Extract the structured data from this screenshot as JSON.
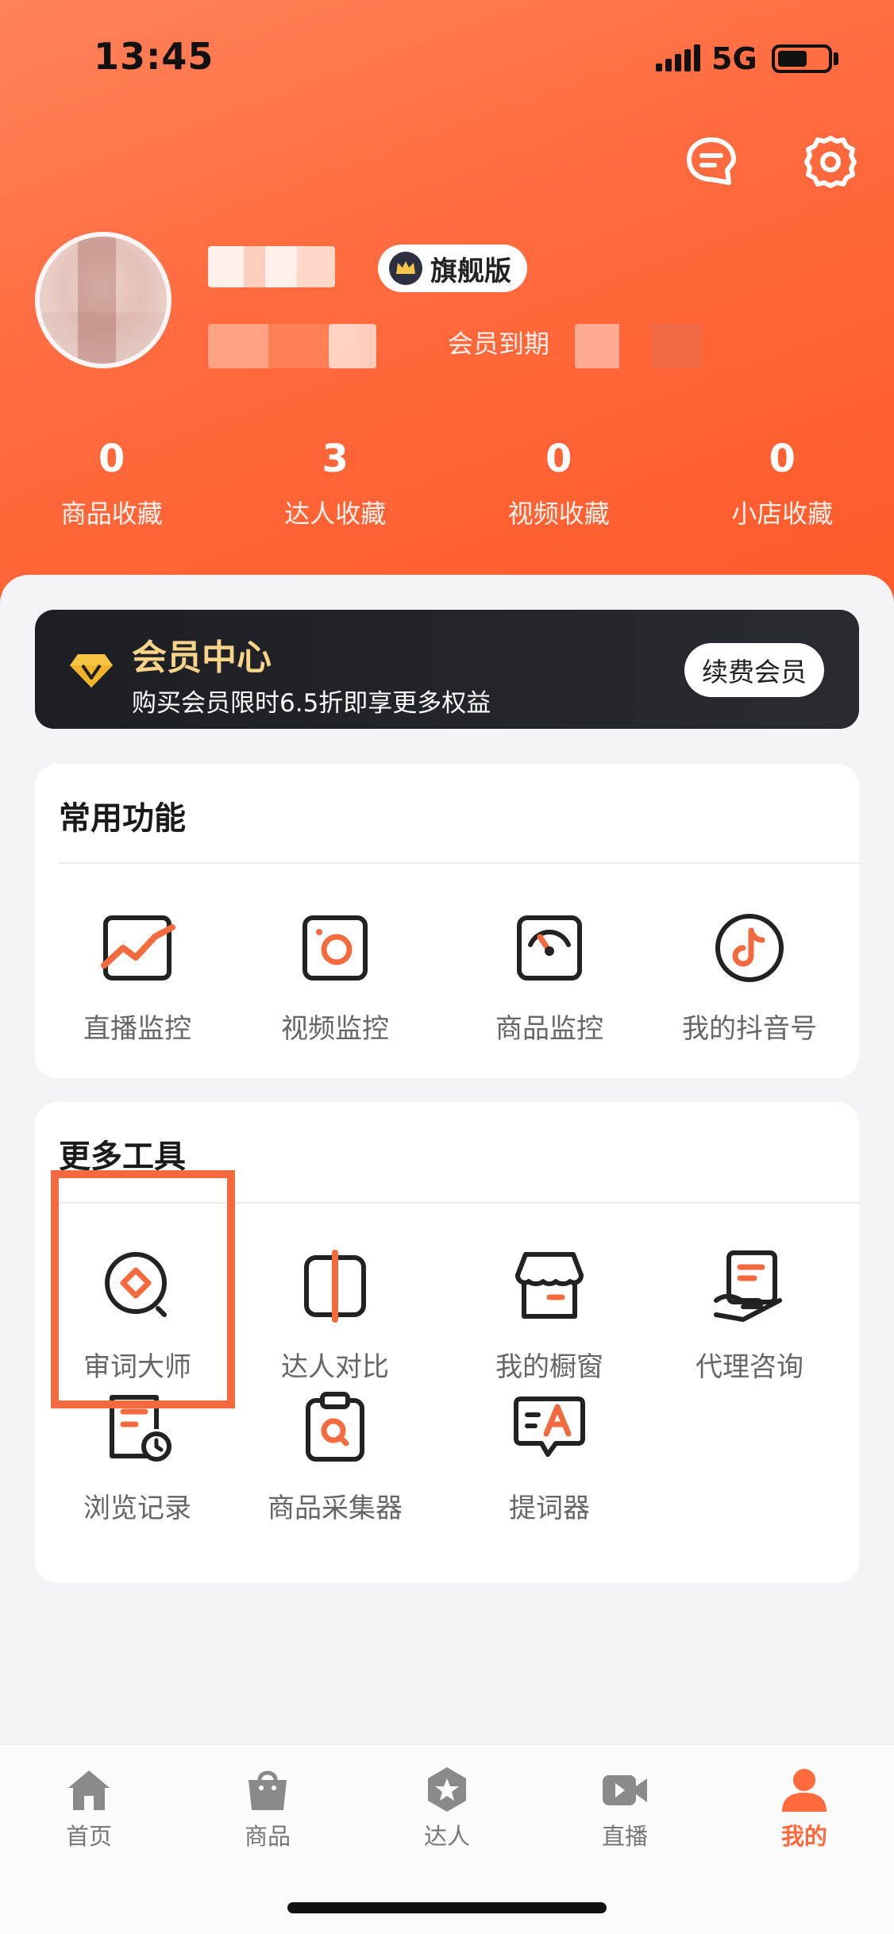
{
  "status_bar": {
    "time": "13:45",
    "network": "5G",
    "battery_level": 0.6
  },
  "header": {
    "icons": [
      "message-icon",
      "settings-icon"
    ],
    "badge_label": "旗舰版",
    "expiry_label": "会员到期",
    "stats": [
      {
        "value": "0",
        "label": "商品收藏"
      },
      {
        "value": "3",
        "label": "达人收藏"
      },
      {
        "value": "0",
        "label": "视频收藏"
      },
      {
        "value": "0",
        "label": "小店收藏"
      }
    ]
  },
  "vip": {
    "title": "会员中心",
    "subtitle": "购买会员限时6.5折即享更多权益",
    "renew_label": "续费会员"
  },
  "common": {
    "title": "常用功能",
    "items": [
      {
        "label": "直播监控",
        "icon": "live-monitor-icon"
      },
      {
        "label": "视频监控",
        "icon": "video-monitor-icon"
      },
      {
        "label": "商品监控",
        "icon": "product-monitor-icon"
      },
      {
        "label": "我的抖音号",
        "icon": "douyin-icon"
      }
    ]
  },
  "more": {
    "title": "更多工具",
    "items": [
      {
        "label": "审词大师",
        "icon": "word-check-icon"
      },
      {
        "label": "达人对比",
        "icon": "compare-icon"
      },
      {
        "label": "我的橱窗",
        "icon": "shop-window-icon"
      },
      {
        "label": "代理咨询",
        "icon": "agent-consult-icon"
      },
      {
        "label": "浏览记录",
        "icon": "history-icon"
      },
      {
        "label": "商品采集器",
        "icon": "collector-icon"
      },
      {
        "label": "提词器",
        "icon": "teleprompter-icon"
      }
    ]
  },
  "tabbar": {
    "active_color": "#ff6a3d",
    "items": [
      {
        "label": "首页",
        "icon": "home-icon"
      },
      {
        "label": "商品",
        "icon": "bag-icon"
      },
      {
        "label": "达人",
        "icon": "star-icon"
      },
      {
        "label": "直播",
        "icon": "video-camera-icon"
      },
      {
        "label": "我的",
        "icon": "user-icon"
      }
    ]
  }
}
